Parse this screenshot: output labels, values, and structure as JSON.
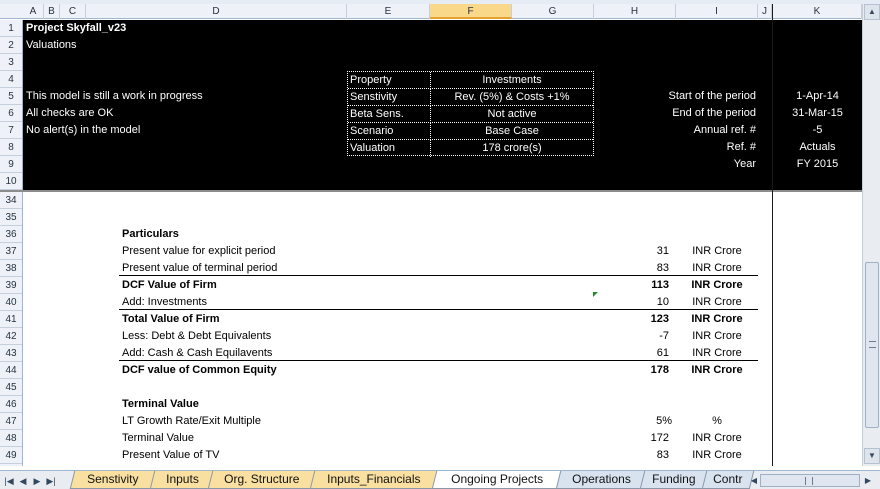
{
  "columns": [
    "A",
    "B",
    "C",
    "D",
    "E",
    "F",
    "G",
    "H",
    "I",
    "J",
    "K"
  ],
  "selected_column": "F",
  "top_rows": [
    "1",
    "2",
    "3",
    "4",
    "5",
    "6",
    "7",
    "8",
    "9",
    "10"
  ],
  "body_rows": [
    "34",
    "35",
    "36",
    "37",
    "38",
    "39",
    "40",
    "41",
    "42",
    "43",
    "44",
    "45",
    "46",
    "47",
    "48",
    "49"
  ],
  "header": {
    "project": "Project Skyfall_v23",
    "subtitle": "Valuations",
    "status_lines": [
      "This model is still a work in progress",
      "All checks are OK",
      "No alert(s) in the model"
    ]
  },
  "infobox": [
    {
      "label": "Property",
      "value": "Investments"
    },
    {
      "label": "Senstivity",
      "value": "Rev. (5%) & Costs +1%"
    },
    {
      "label": "Beta Sens.",
      "value": "Not active"
    },
    {
      "label": "Scenario",
      "value": "Base Case"
    },
    {
      "label": "Valuation",
      "value": "178 crore(s)"
    }
  ],
  "period": [
    {
      "label": "Start of the period",
      "value": "1-Apr-14"
    },
    {
      "label": "End of the period",
      "value": "31-Mar-15"
    },
    {
      "label": "Annual ref. #",
      "value": "-5"
    },
    {
      "label": "Ref. #",
      "value": "Actuals"
    },
    {
      "label": "Year",
      "value": "FY 2015"
    }
  ],
  "particulars": {
    "heading": "Particulars",
    "rows": [
      {
        "label": "Present value for explicit period",
        "value": "31",
        "unit": "INR Crore",
        "bold": false
      },
      {
        "label": "Present value of terminal period",
        "value": "83",
        "unit": "INR Crore",
        "bold": false
      },
      {
        "label": "DCF Value of Firm",
        "value": "113",
        "unit": "INR Crore",
        "bold": true
      },
      {
        "label": "Add: Investments",
        "value": "10",
        "unit": "INR Crore",
        "bold": false
      },
      {
        "label": "Total Value of Firm",
        "value": "123",
        "unit": "INR Crore",
        "bold": true
      },
      {
        "label": "Less: Debt & Debt Equivalents",
        "value": "-7",
        "unit": "INR Crore",
        "bold": false
      },
      {
        "label": "Add: Cash & Cash Equilavents",
        "value": "61",
        "unit": "INR Crore",
        "bold": false
      },
      {
        "label": "DCF value of Common Equity",
        "value": "178",
        "unit": "INR Crore",
        "bold": true
      }
    ]
  },
  "terminal": {
    "heading": "Terminal Value",
    "rows": [
      {
        "label": "LT Growth Rate/Exit Multiple",
        "value": "5%",
        "unit": "%"
      },
      {
        "label": "Terminal Value",
        "value": "172",
        "unit": "INR Crore"
      },
      {
        "label": "Present Value of TV",
        "value": "83",
        "unit": "INR Crore"
      }
    ]
  },
  "tabs": [
    "Senstivity",
    "Inputs",
    "Org. Structure",
    "Inputs_Financials",
    "Ongoing Projects",
    "Operations",
    "Funding",
    "Contr"
  ],
  "tab_nav": [
    "first-sheet-icon",
    "prev-sheet-icon",
    "next-sheet-icon",
    "last-sheet-icon"
  ]
}
